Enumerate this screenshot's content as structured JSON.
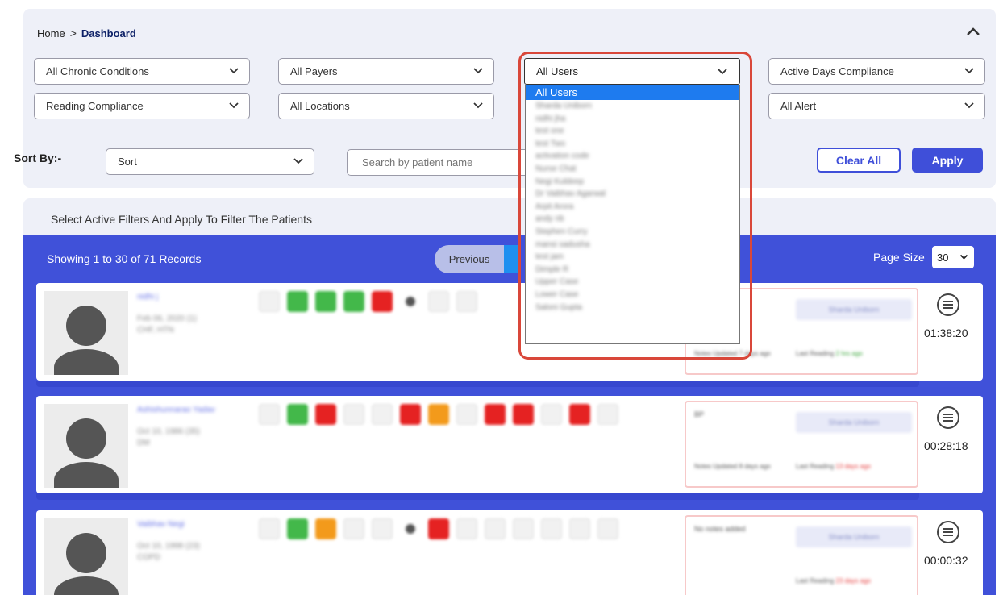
{
  "breadcrumb": {
    "home": "Home",
    "separator": ">",
    "current": "Dashboard"
  },
  "filters": {
    "chronic": "All Chronic Conditions",
    "payers": "All Payers",
    "users": "All Users",
    "active_days": "Active Days Compliance",
    "reading": "Reading Compliance",
    "locations": "All Locations",
    "alert": "All Alert"
  },
  "sort": {
    "label": "Sort By:-",
    "value": "Sort"
  },
  "search": {
    "placeholder": "Search by patient name"
  },
  "buttons": {
    "clear": "Clear All",
    "apply": "Apply"
  },
  "active_filters_text": "Select Active Filters And Apply To Filter The Patients",
  "results": {
    "records": "Showing 1 to 30 of 71 Records",
    "previous": "Previous",
    "page_size_label": "Page Size",
    "page_size": "30"
  },
  "users_dropdown": {
    "options": [
      "All Users",
      "Sharda Uniborn",
      "nidhi jha",
      "test one",
      "test Two",
      "activation code",
      "Nurse Chat",
      "Negi Kuldeep",
      "Dr Vaibhav Agarwal",
      "Arpit Arora",
      "andy nb",
      "Stephen Curry",
      "mansi sadusha",
      "test jam",
      "Dimple R",
      "Upper Case",
      "Lower Case",
      "Saloni Gupta"
    ]
  },
  "patients": [
    {
      "name": "nidhi j",
      "dob": "Feb 06, 2020 (1)",
      "condition": "CHF, HTN",
      "note": "",
      "assignee": "Sharda Uniborn",
      "notes_updated": "Notes Updated 7 days ago",
      "last_reading": "Last Reading",
      "last_reading_ago": "2 hrs ago",
      "timer": "01:38:20"
    },
    {
      "name": "Ashishunnarao Yadav",
      "dob": "Oct 10, 1986 (35)",
      "condition": "DM",
      "note": "BP",
      "assignee": "Sharda Uniborn",
      "notes_updated": "Notes Updated 8 days ago",
      "last_reading": "Last Reading",
      "last_reading_ago": "13 days ago",
      "timer": "00:28:18"
    },
    {
      "name": "Vaibhav Negi",
      "dob": "Oct 10, 1998 (23)",
      "condition": "COPD",
      "note": "No notes added",
      "assignee": "Sharda Uniborn",
      "notes_updated": "",
      "last_reading": "Last Reading",
      "last_reading_ago": "23 days ago",
      "timer": "00:00:32"
    }
  ],
  "colors": {
    "primary": "#4051d9",
    "panel": "#eef0f8",
    "highlight": "#d9473a",
    "selected_option": "#1e7bef"
  }
}
